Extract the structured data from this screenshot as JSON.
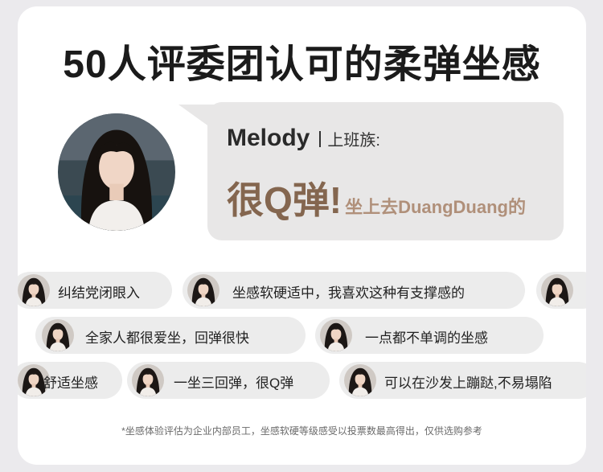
{
  "title": "50人评委团认可的柔弹坐感",
  "featured": {
    "name": "Melody",
    "role": "上班族:",
    "quote_main": "很Q弹!",
    "quote_sub": "坐上去DuangDuang的"
  },
  "reviews": [
    {
      "text": "纠结党闭眼入"
    },
    {
      "text": "坐感软硬适中，我喜欢这种有支撑感的"
    },
    {
      "text": "全家人都很爱坐，回弹很快"
    },
    {
      "text": "一点都不单调的坐感"
    },
    {
      "text": "舒适坐感"
    },
    {
      "text": "一坐三回弹，很Q弹"
    },
    {
      "text": "可以在沙发上蹦跶,不易塌陷"
    }
  ],
  "footnote": "*坐感体验评估为企业内部员工，坐感软硬等级感受以投票数最高得出，仅供选购参考",
  "colors": {
    "accent": "#84664f",
    "accent_light": "#b0907a",
    "bubble": "#e8e7e7",
    "pill": "#ececec",
    "page_bg": "#ebeaed"
  }
}
